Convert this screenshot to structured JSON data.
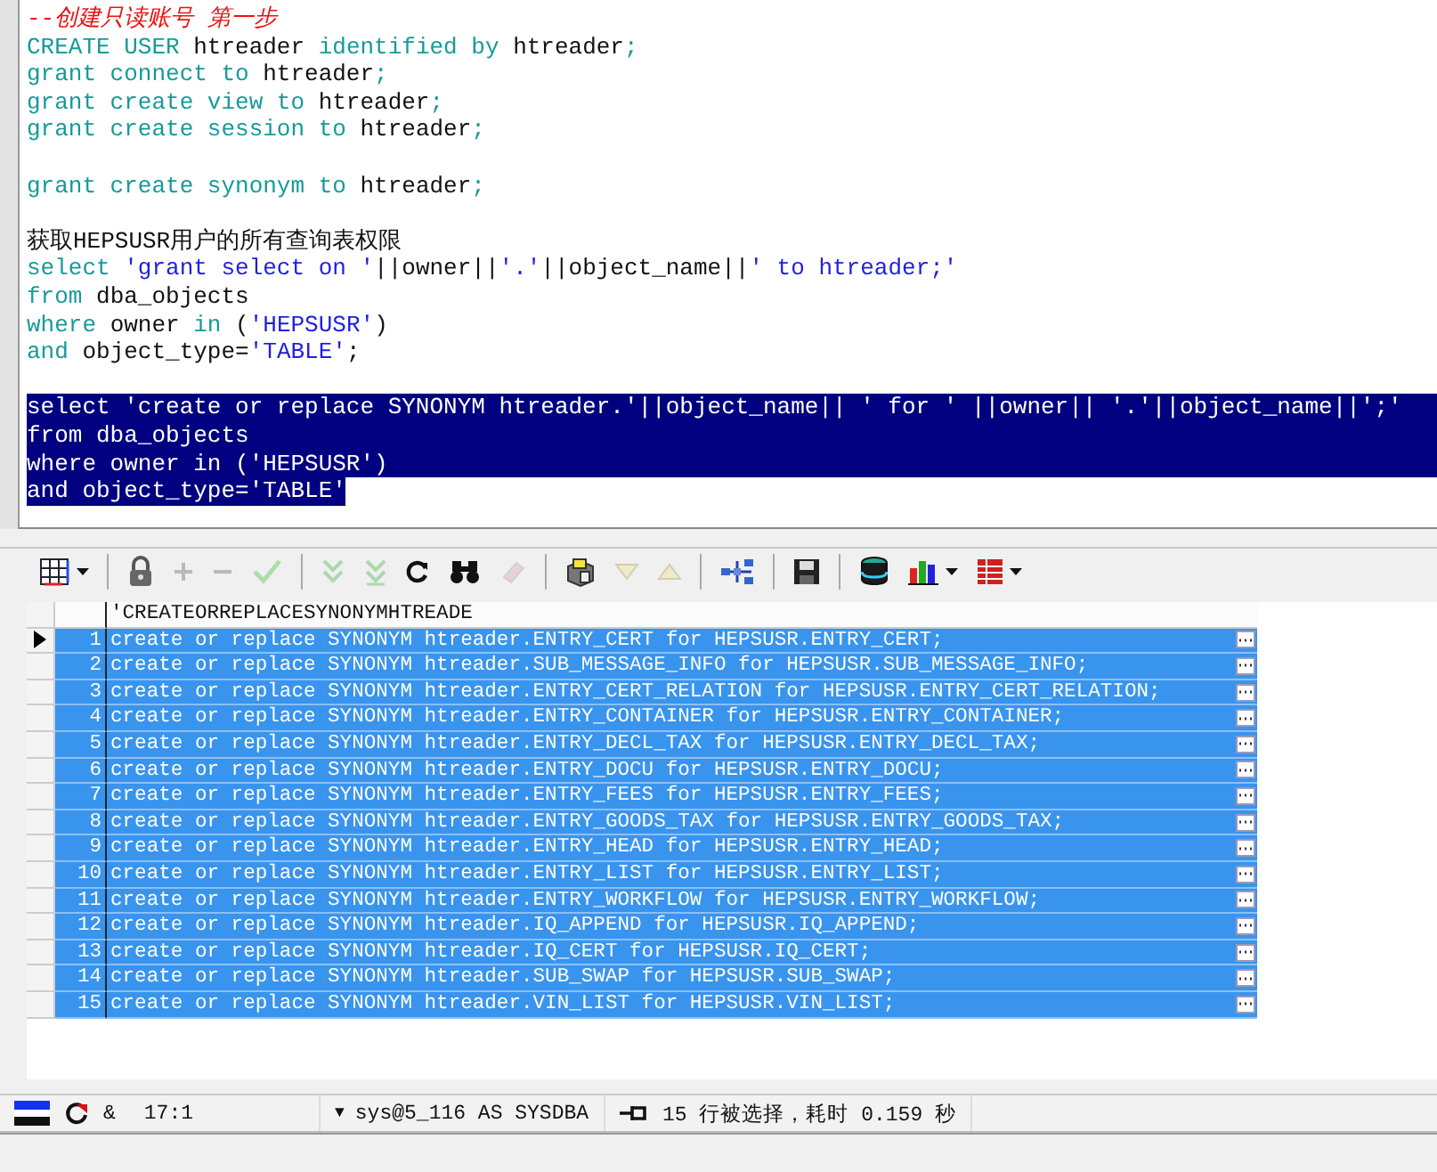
{
  "editor": {
    "lines": [
      {
        "kind": "code",
        "selected": false,
        "tokens": [
          {
            "kind": "comment",
            "text": "--创建只读账号 第一步"
          }
        ]
      },
      {
        "kind": "code",
        "selected": false,
        "tokens": [
          {
            "kind": "keyword",
            "text": "CREATE USER "
          },
          {
            "kind": "plain",
            "text": "htreader "
          },
          {
            "kind": "keyword",
            "text": "identified by "
          },
          {
            "kind": "plain",
            "text": "htreader"
          },
          {
            "kind": "keyword",
            "text": ";"
          }
        ]
      },
      {
        "kind": "code",
        "selected": false,
        "tokens": [
          {
            "kind": "keyword",
            "text": "grant connect to "
          },
          {
            "kind": "plain",
            "text": "htreader"
          },
          {
            "kind": "keyword",
            "text": ";"
          }
        ]
      },
      {
        "kind": "code",
        "selected": false,
        "tokens": [
          {
            "kind": "keyword",
            "text": "grant create view to "
          },
          {
            "kind": "plain",
            "text": "htreader"
          },
          {
            "kind": "keyword",
            "text": ";"
          }
        ]
      },
      {
        "kind": "code",
        "selected": false,
        "tokens": [
          {
            "kind": "keyword",
            "text": "grant create session to "
          },
          {
            "kind": "plain",
            "text": "htreader"
          },
          {
            "kind": "keyword",
            "text": ";"
          }
        ]
      },
      {
        "kind": "blank"
      },
      {
        "kind": "code",
        "selected": false,
        "tokens": [
          {
            "kind": "keyword",
            "text": "grant create synonym to "
          },
          {
            "kind": "plain",
            "text": "htreader"
          },
          {
            "kind": "keyword",
            "text": ";"
          }
        ]
      },
      {
        "kind": "blank"
      },
      {
        "kind": "code",
        "selected": false,
        "tokens": [
          {
            "kind": "plain",
            "text": "获取HEPSUSR用户的所有查询表权限"
          }
        ]
      },
      {
        "kind": "code",
        "selected": false,
        "tokens": [
          {
            "kind": "keyword",
            "text": "select "
          },
          {
            "kind": "string",
            "text": "'grant select on '"
          },
          {
            "kind": "plain",
            "text": "||owner||"
          },
          {
            "kind": "string",
            "text": "'.'"
          },
          {
            "kind": "plain",
            "text": "||object_name||"
          },
          {
            "kind": "string",
            "text": "' to htreader;'"
          }
        ]
      },
      {
        "kind": "code",
        "selected": false,
        "tokens": [
          {
            "kind": "keyword",
            "text": "from "
          },
          {
            "kind": "plain",
            "text": "dba_objects"
          }
        ]
      },
      {
        "kind": "code",
        "selected": false,
        "tokens": [
          {
            "kind": "keyword",
            "text": "where "
          },
          {
            "kind": "plain",
            "text": "owner "
          },
          {
            "kind": "keyword",
            "text": "in "
          },
          {
            "kind": "plain",
            "text": "("
          },
          {
            "kind": "string",
            "text": "'HEPSUSR'"
          },
          {
            "kind": "plain",
            "text": ")"
          }
        ]
      },
      {
        "kind": "code",
        "selected": false,
        "tokens": [
          {
            "kind": "keyword",
            "text": "and "
          },
          {
            "kind": "plain",
            "text": "object_type="
          },
          {
            "kind": "string",
            "text": "'TABLE'"
          },
          {
            "kind": "plain",
            "text": ";"
          }
        ]
      },
      {
        "kind": "blank"
      },
      {
        "kind": "code",
        "selected": true,
        "text": "select 'create or replace SYNONYM htreader.'||object_name|| ' for ' ||owner|| '.'||object_name||';'"
      },
      {
        "kind": "code",
        "selected": true,
        "text": "from dba_objects"
      },
      {
        "kind": "code",
        "selected": true,
        "text": "where owner in ('HEPSUSR')"
      },
      {
        "kind": "code",
        "selected": true,
        "text": "and object_type='TABLE'"
      }
    ]
  },
  "toolbar": {
    "groups": [
      {
        "buttons": [
          {
            "kind": "grid",
            "disabled": false,
            "dropdown": true
          }
        ]
      },
      {
        "buttons": [
          {
            "kind": "lock",
            "disabled": false,
            "dropdown": false
          },
          {
            "kind": "add",
            "disabled": true,
            "dropdown": false
          },
          {
            "kind": "remove",
            "disabled": true,
            "dropdown": false
          },
          {
            "kind": "post",
            "disabled": true,
            "dropdown": false
          }
        ]
      },
      {
        "buttons": [
          {
            "kind": "next",
            "disabled": true,
            "dropdown": false
          },
          {
            "kind": "last",
            "disabled": true,
            "dropdown": false
          },
          {
            "kind": "refresh",
            "disabled": false,
            "dropdown": false
          },
          {
            "kind": "find",
            "disabled": false,
            "dropdown": false
          },
          {
            "kind": "clear",
            "disabled": true,
            "dropdown": false
          }
        ]
      },
      {
        "buttons": [
          {
            "kind": "import",
            "disabled": false,
            "dropdown": false
          },
          {
            "kind": "down",
            "disabled": true,
            "dropdown": false
          },
          {
            "kind": "up",
            "disabled": true,
            "dropdown": false
          }
        ]
      },
      {
        "buttons": [
          {
            "kind": "connect",
            "disabled": false,
            "dropdown": false
          }
        ]
      },
      {
        "buttons": [
          {
            "kind": "save",
            "disabled": false,
            "dropdown": false
          }
        ]
      },
      {
        "buttons": [
          {
            "kind": "db",
            "disabled": false,
            "dropdown": false
          },
          {
            "kind": "chart",
            "disabled": false,
            "dropdown": true
          },
          {
            "kind": "table",
            "disabled": false,
            "dropdown": true
          }
        ]
      }
    ]
  },
  "result_grid": {
    "columns": [
      "'CREATEORREPLACESYNONYMHTREADE"
    ],
    "rows": [
      {
        "number": "1",
        "value": "create or replace SYNONYM htreader.ENTRY_CERT for HEPSUSR.ENTRY_CERT;",
        "current": true,
        "selected": true
      },
      {
        "number": "2",
        "value": "create or replace SYNONYM htreader.SUB_MESSAGE_INFO for HEPSUSR.SUB_MESSAGE_INFO;",
        "current": false,
        "selected": true
      },
      {
        "number": "3",
        "value": "create or replace SYNONYM htreader.ENTRY_CERT_RELATION for HEPSUSR.ENTRY_CERT_RELATION;",
        "current": false,
        "selected": true
      },
      {
        "number": "4",
        "value": "create or replace SYNONYM htreader.ENTRY_CONTAINER for HEPSUSR.ENTRY_CONTAINER;",
        "current": false,
        "selected": true
      },
      {
        "number": "5",
        "value": "create or replace SYNONYM htreader.ENTRY_DECL_TAX for HEPSUSR.ENTRY_DECL_TAX;",
        "current": false,
        "selected": true
      },
      {
        "number": "6",
        "value": "create or replace SYNONYM htreader.ENTRY_DOCU for HEPSUSR.ENTRY_DOCU;",
        "current": false,
        "selected": true
      },
      {
        "number": "7",
        "value": "create or replace SYNONYM htreader.ENTRY_FEES for HEPSUSR.ENTRY_FEES;",
        "current": false,
        "selected": true
      },
      {
        "number": "8",
        "value": "create or replace SYNONYM htreader.ENTRY_GOODS_TAX for HEPSUSR.ENTRY_GOODS_TAX;",
        "current": false,
        "selected": true
      },
      {
        "number": "9",
        "value": "create or replace SYNONYM htreader.ENTRY_HEAD for HEPSUSR.ENTRY_HEAD;",
        "current": false,
        "selected": true
      },
      {
        "number": "10",
        "value": "create or replace SYNONYM htreader.ENTRY_LIST for HEPSUSR.ENTRY_LIST;",
        "current": false,
        "selected": true
      },
      {
        "number": "11",
        "value": "create or replace SYNONYM htreader.ENTRY_WORKFLOW for HEPSUSR.ENTRY_WORKFLOW;",
        "current": false,
        "selected": true
      },
      {
        "number": "12",
        "value": "create or replace SYNONYM htreader.IQ_APPEND for HEPSUSR.IQ_APPEND;",
        "current": false,
        "selected": true
      },
      {
        "number": "13",
        "value": "create or replace SYNONYM htreader.IQ_CERT for HEPSUSR.IQ_CERT;",
        "current": false,
        "selected": true
      },
      {
        "number": "14",
        "value": "create or replace SYNONYM htreader.SUB_SWAP for HEPSUSR.SUB_SWAP;",
        "current": false,
        "selected": true
      },
      {
        "number": "15",
        "value": "create or replace SYNONYM htreader.VIN_LIST for HEPSUSR.VIN_LIST;",
        "current": false,
        "selected": true
      }
    ]
  },
  "status_bar": {
    "mode": "&",
    "position": "17:1",
    "connection_caret": "▼",
    "connection": "sys@5_116 AS SYSDBA",
    "message": "15 行被选择，耗时 0.159 秒"
  }
}
